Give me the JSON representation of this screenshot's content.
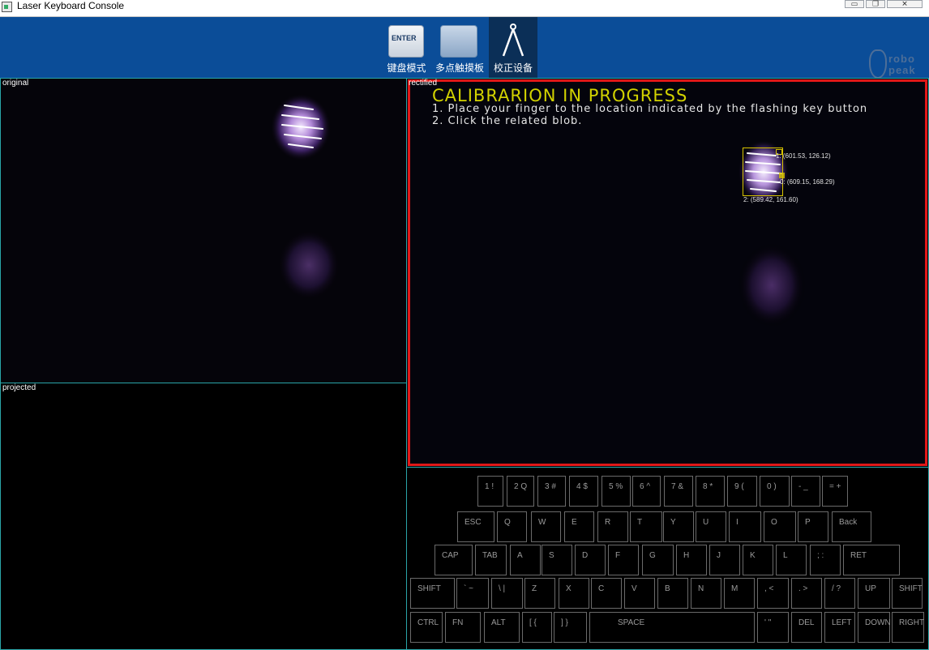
{
  "window": {
    "title": "Laser Keyboard Console"
  },
  "toolbar": {
    "buttons": [
      {
        "label": "键盘模式",
        "icon": "enter-key-icon",
        "icon_text": "ENTER"
      },
      {
        "label": "多点触摸板",
        "icon": "touchpad-icon"
      },
      {
        "label": "校正设备",
        "icon": "compass-icon",
        "active": true
      }
    ],
    "logo": {
      "line1": "robo",
      "line2": "peak"
    }
  },
  "panes": {
    "original": {
      "label": "original"
    },
    "projected": {
      "label": "projected"
    },
    "rectified": {
      "label": "rectified",
      "title": "CALIBRARION IN PROGRESS",
      "instructions": [
        "1. Place your finger to the location indicated by the flashing key button",
        "2. Click the related blob."
      ],
      "points": [
        "1: (601.53, 126.12)",
        "0: (609.15, 168.29)",
        "2: (589.42, 161.60)"
      ]
    }
  },
  "keyboard": {
    "rows": [
      [
        "1 !",
        "2 Q",
        "3 #",
        "4 $",
        "5 %",
        "6 ^",
        "7 &",
        "8 *",
        "9 (",
        "0 )",
        "- _",
        "= +"
      ],
      [
        "ESC",
        "Q",
        "W",
        "E",
        "R",
        "T",
        "Y",
        "U",
        "I",
        "O",
        "P",
        "Back"
      ],
      [
        "CAP",
        "TAB",
        "A",
        "S",
        "D",
        "F",
        "G",
        "H",
        "J",
        "K",
        "L",
        "; :",
        "RET"
      ],
      [
        "SHIFT",
        "` ~",
        "\\ |",
        "Z",
        "X",
        "C",
        "V",
        "B",
        "N",
        "M",
        ", <",
        ". >",
        "/ ?",
        "UP",
        "SHIFT"
      ],
      [
        "CTRL",
        "FN",
        "ALT",
        "[ {",
        "] }",
        "SPACE",
        "' \"",
        "DEL",
        "LEFT",
        "DOWN",
        "RIGHT"
      ]
    ]
  },
  "colors": {
    "toolbar_bg": "#0b4d98",
    "toolbar_active": "#0b2f57",
    "pane_border": "#2aa5a8",
    "rectified_border": "#e01818",
    "calibration_title": "#d2d200",
    "key_border": "#6a6a6a"
  }
}
